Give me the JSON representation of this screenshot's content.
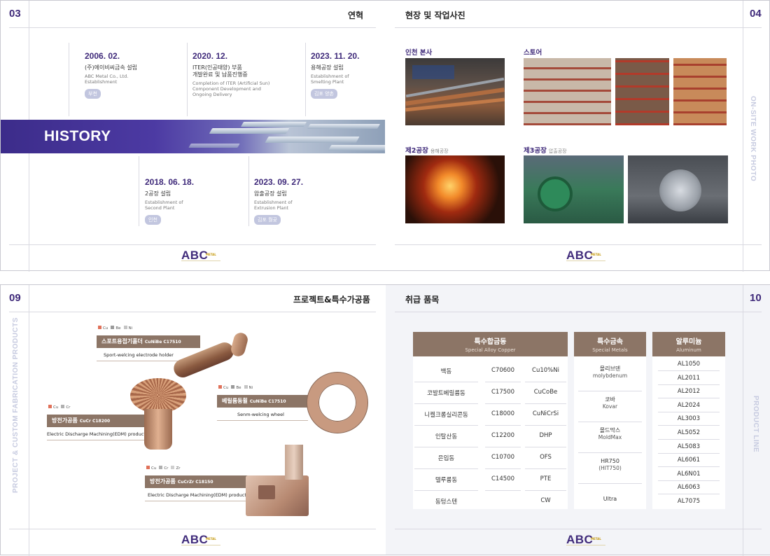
{
  "spread_top": {
    "left_page": {
      "number": "03",
      "title": "연혁",
      "band_label": "HISTORY",
      "events_top": [
        {
          "date": "2006. 02.",
          "ko": "(주)에이비씨금속 설립",
          "en": "ABC Metal Co., Ltd.\nEstablishment",
          "badge": "부천"
        },
        {
          "date": "2020. 12.",
          "ko": "ITER(인공태양) 부품\n개발완료 및 납품진행중",
          "en": "Completion of ITER (Artificial Sun)\nComponent Development and\nOngoing Delivery",
          "badge": ""
        },
        {
          "date": "2023. 11. 20.",
          "ko": "용해공장 설립",
          "en": "Establishment of\nSmelting Plant",
          "badge": "김포 양촌"
        }
      ],
      "events_bottom": [
        {
          "date": "2018. 06. 18.",
          "ko": "2공장 설립",
          "en": "Establishment of\nSecond Plant",
          "badge": "인천"
        },
        {
          "date": "2023. 09. 27.",
          "ko": "압출공장 설립",
          "en": "Establishment of\nExtrusion Plant",
          "badge": "김포 월곶"
        }
      ],
      "logo": {
        "text": "ABC",
        "sup": "METAL"
      }
    },
    "right_page": {
      "number": "04",
      "title": "현장 및 작업사진",
      "side_text": "ON-SITE WORK PHOTO",
      "groups": [
        {
          "label": "인천 본사",
          "sub": ""
        },
        {
          "label": "스토어",
          "sub": ""
        },
        {
          "label": "제2공장",
          "sub": "용해공장"
        },
        {
          "label": "제3공장",
          "sub": "압출공장"
        }
      ],
      "logo": {
        "text": "ABC",
        "sup": "METAL"
      }
    }
  },
  "spread_bottom": {
    "left_page": {
      "number": "09",
      "title": "프로젝트&특수가공품",
      "side_text": "PROJECT & CUSTOM FABRICATION PRODUCTS",
      "products": [
        {
          "name": "스포트용접기홀더",
          "code": "CuNiBe C17510",
          "en": "Sport-welcing electrode holder",
          "chips": [
            "Cu",
            "Be",
            "Ni"
          ]
        },
        {
          "name": "방전가공품",
          "code": "CuCr C18200",
          "en": "Electric Discharge Machining(EDM) product",
          "chips": [
            "Cu",
            "Cr"
          ]
        },
        {
          "name": "베릴륨동휠",
          "code": "CuNiBe C17510",
          "en": "Senm-welcing wheel",
          "chips": [
            "Cu",
            "Be",
            "Ni"
          ]
        },
        {
          "name": "방전가공품",
          "code": "CuCrZr C18150",
          "en": "Electric Discharge Machining(EDM) product",
          "chips": [
            "Cu",
            "Cr",
            "Zr"
          ]
        }
      ],
      "chip_colors": {
        "Cu": "#e0715a",
        "Be": "#9a9a9a",
        "Ni": "#c4c4c4",
        "Cr": "#b0b0b0",
        "Zr": "#cfcfcf"
      },
      "logo": {
        "text": "ABC",
        "sup": "METAL"
      }
    },
    "right_page": {
      "number": "10",
      "title": "취급 품목",
      "side_text": "PRODUCT LINE",
      "alloy": {
        "header_ko": "특수합금동",
        "header_en": "Special Alloy Copper",
        "rows": [
          [
            "백동",
            "C70600",
            "Cu10%Ni"
          ],
          [
            "코발트베릴륨동",
            "C17500",
            "CuCoBe"
          ],
          [
            "니켈크롬실리콘동",
            "C18000",
            "CuNiCrSi"
          ],
          [
            "인탈산동",
            "C12200",
            "DHP"
          ],
          [
            "은입동",
            "C10700",
            "OFS"
          ],
          [
            "텔루륨동",
            "C14500",
            "PTE"
          ],
          [
            "동텅스텐",
            "",
            "CW"
          ]
        ]
      },
      "special": {
        "header_ko": "특수금속",
        "header_en": "Special Metals",
        "rows": [
          {
            "ko": "몰리브덴",
            "en": "molybdenum"
          },
          {
            "ko": "코바",
            "en": "Kovar"
          },
          {
            "ko": "몰드막스",
            "en": "MoldMax"
          },
          {
            "ko": "HR750",
            "en": "(HIT750)"
          },
          {
            "ko": "Ultra",
            "en": ""
          }
        ]
      },
      "aluminum": {
        "header_ko": "알루미늄",
        "header_en": "Aluminum",
        "rows": [
          "AL1050",
          "AL2011",
          "AL2012",
          "AL2024",
          "AL3003",
          "AL5052",
          "AL5083",
          "AL6061",
          "AL6N01",
          "AL6063",
          "AL7075"
        ]
      },
      "logo": {
        "text": "ABC",
        "sup": "METAL"
      }
    }
  }
}
